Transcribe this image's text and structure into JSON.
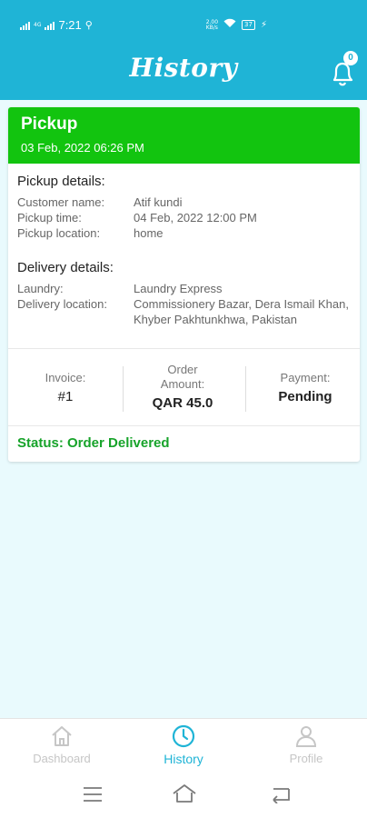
{
  "status_bar": {
    "time": "7:21",
    "net_left": "4G",
    "net_small_top": "2.00",
    "net_small_bottom": "KB/s",
    "battery": "37"
  },
  "header": {
    "title": "History",
    "notification_count": "0"
  },
  "order": {
    "type": "Pickup",
    "datetime": "03 Feb, 2022 06:26 PM",
    "pickup_section": "Pickup details:",
    "pickup": [
      {
        "label": "Customer name:",
        "value": "Atif kundi"
      },
      {
        "label": "Pickup time:",
        "value": "04 Feb, 2022 12:00 PM"
      },
      {
        "label": "Pickup location:",
        "value": "home"
      }
    ],
    "delivery_section": "Delivery details:",
    "delivery": [
      {
        "label": "Laundry:",
        "value": "Laundry Express"
      },
      {
        "label": "Delivery location:",
        "value": "Commissionery Bazar, Dera Ismail Khan, Khyber Pakhtunkhwa, Pakistan"
      }
    ],
    "invoice_label": "Invoice:",
    "invoice_value": "#1",
    "amount_label": "Order Amount:",
    "amount_value": "QAR 45.0",
    "payment_label": "Payment:",
    "payment_value": "Pending",
    "status": "Status: Order Delivered"
  },
  "bottom_nav": [
    {
      "label": "Dashboard",
      "icon": "home-icon",
      "active": false
    },
    {
      "label": "History",
      "icon": "clock-icon",
      "active": true
    },
    {
      "label": "Profile",
      "icon": "user-icon",
      "active": false
    }
  ],
  "colors": {
    "header": "#1fb4d6",
    "card_header": "#12c40f",
    "status": "#17a32a",
    "background": "#e9fafd"
  }
}
